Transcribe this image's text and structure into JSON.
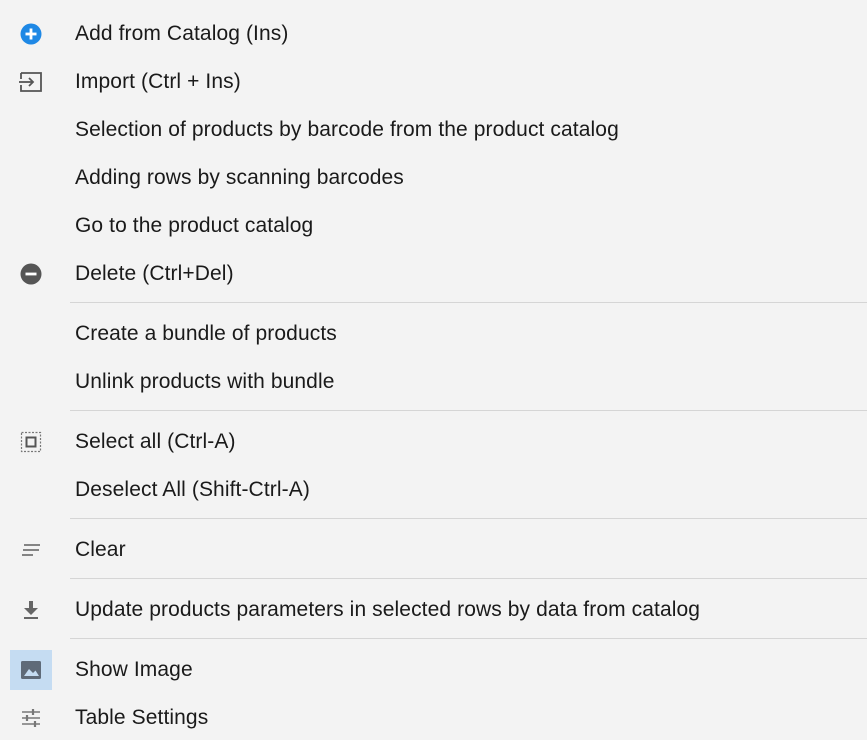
{
  "menu": {
    "items": [
      {
        "label": "Add from Catalog (Ins)",
        "icon": "plus-circle-icon"
      },
      {
        "label": "Import (Ctrl + Ins)",
        "icon": "import-icon"
      },
      {
        "label": "Selection of products by barcode from the product catalog",
        "icon": ""
      },
      {
        "label": "Adding rows by scanning barcodes",
        "icon": ""
      },
      {
        "label": "Go to the product catalog",
        "icon": ""
      },
      {
        "label": "Delete (Ctrl+Del)",
        "icon": "minus-circle-icon"
      },
      {
        "label": "Create a bundle of products",
        "icon": ""
      },
      {
        "label": "Unlink products with bundle",
        "icon": ""
      },
      {
        "label": "Select all (Ctrl-A)",
        "icon": "select-all-icon"
      },
      {
        "label": "Deselect All (Shift-Ctrl-A)",
        "icon": ""
      },
      {
        "label": "Clear",
        "icon": "clear-icon"
      },
      {
        "label": "Update products parameters in selected rows by data from catalog",
        "icon": "download-icon"
      },
      {
        "label": "Show Image",
        "icon": "image-icon"
      },
      {
        "label": "Table Settings",
        "icon": "settings-sliders-icon"
      }
    ]
  },
  "colors": {
    "background": "#f3f3f3",
    "accent_blue": "#1e88e5",
    "icon_gray": "#555555",
    "highlight": "#c5dcf2"
  }
}
